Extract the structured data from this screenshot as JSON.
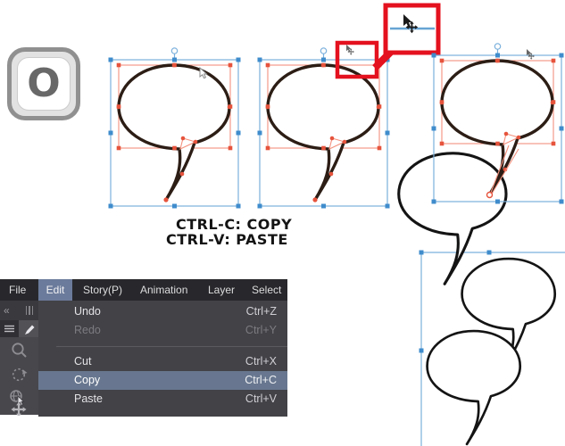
{
  "key_hint": {
    "label": "O"
  },
  "caption": {
    "line1": "CTRL-C: COPY",
    "line2": "CTRL-V: PASTE"
  },
  "menu_bar": {
    "items": [
      {
        "label": "File"
      },
      {
        "label": "Edit",
        "active": true
      },
      {
        "label": "Story(P)"
      },
      {
        "label": "Animation"
      },
      {
        "label": "Layer"
      },
      {
        "label": "Select"
      }
    ]
  },
  "edit_menu": {
    "items": [
      {
        "label": "Undo",
        "shortcut": "Ctrl+Z",
        "state": "normal"
      },
      {
        "label": "Redo",
        "shortcut": "Ctrl+Y",
        "state": "disabled"
      },
      {
        "label": "Cut",
        "shortcut": "Ctrl+X",
        "state": "normal"
      },
      {
        "label": "Copy",
        "shortcut": "Ctrl+C",
        "state": "highlighted"
      },
      {
        "label": "Paste",
        "shortcut": "Ctrl+V",
        "state": "normal"
      }
    ]
  },
  "toolstrip": {
    "icons": [
      "collapse-icon",
      "grip-icon",
      "menu-icon",
      "pen-tool-icon",
      "zoom-tool-icon",
      "rotate-tool-icon",
      "object-tool-icon",
      "move-tool-icon"
    ]
  },
  "canvas": {
    "bubbles": [
      {
        "id": "bubble-1",
        "state": "selected"
      },
      {
        "id": "bubble-2",
        "state": "selected"
      },
      {
        "id": "bubble-3",
        "state": "selected"
      },
      {
        "id": "bubble-moving",
        "state": "plain"
      },
      {
        "id": "bubble-pasted-top",
        "state": "plain"
      },
      {
        "id": "bubble-pasted-bottom",
        "state": "plain"
      }
    ],
    "cursors": [
      "arrow-cursor",
      "move-cursor"
    ],
    "callout": {
      "shape": "zoom-highlight",
      "content": "selection-edge-with-move-cursor"
    }
  },
  "colors": {
    "selection_blue": "#7ab0dc",
    "selection_handle": "#3f8ccc",
    "control_red": "#e6533c",
    "control_line": "#f4917d",
    "bubble_outline": "#2c1d15",
    "plain_outline": "#141414",
    "callout_red": "#e4111e",
    "menu_highlight": "#68778f",
    "menubar_highlight": "#6b7b9b"
  }
}
